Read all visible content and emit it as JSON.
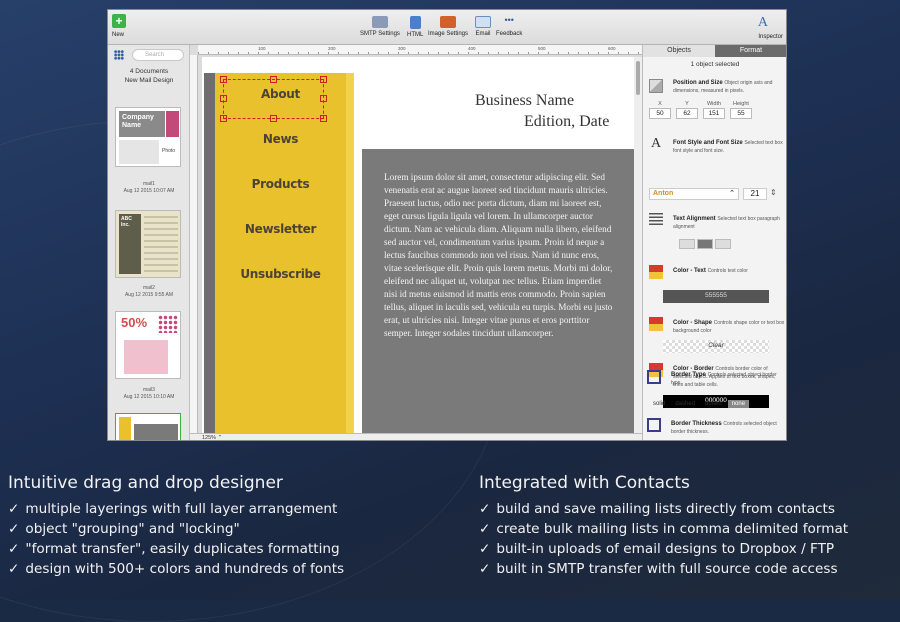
{
  "toolbar": {
    "new_label": "New",
    "buttons": [
      {
        "label": "SMTP Settings",
        "icon": "smtp-icon"
      },
      {
        "label": "HTML",
        "icon": "html-icon"
      },
      {
        "label": "Image Settings",
        "icon": "image-settings-icon"
      },
      {
        "label": "Email",
        "icon": "email-icon"
      },
      {
        "label": "Feedback",
        "icon": "feedback-icon"
      }
    ],
    "inspector_label": "Inspector"
  },
  "sidebar": {
    "search_placeholder": "Search",
    "doc_count": "4 Documents",
    "doc_subtitle": "New Mail Design",
    "thumbs": [
      {
        "name": "mail1",
        "date": "Aug 12 2015 10:07 AM",
        "title": "Company Name",
        "photo": "Photo"
      },
      {
        "name": "mail2",
        "date": "Aug 12 2015 9:55 AM",
        "title": "ABC Inc."
      },
      {
        "name": "mail3",
        "date": "Aug 12 2015 10:10 AM",
        "title": "50%"
      },
      {
        "name": "",
        "date": ""
      }
    ]
  },
  "canvas": {
    "ruler_labels": [
      "100",
      "200",
      "300",
      "400",
      "500",
      "600"
    ],
    "zoom": "125%",
    "nav_items": [
      "About",
      "News",
      "Products",
      "Newsletter",
      "Unsubscribe"
    ],
    "business_name": "Business Name",
    "edition_date": "Edition, Date",
    "body": "Lorem ipsum dolor sit amet, consectetur adipiscing elit. Sed venenatis erat ac augue laoreet sed tincidunt mauris ultricies. Praesent luctus, odio nec porta dictum, diam mi laoreet est, eget cursus ligula ligula vel lorem. In ullamcorper auctor dictum. Nam ac vehicula diam. Aliquam nulla libero, eleifend sed auctor vel, condimentum varius ipsum. Proin id neque a lectus faucibus commodo non vel risus. Nam id nunc eros, vitae scelerisque elit. Proin quis lorem metus. Morbi mi dolor, eleifend nec aliquet ut, volutpat nec tellus. Etiam imperdiet nisi id metus euismod id mattis eros commodo. Proin sapien tellus, aliquet in iaculis sed, vehicula eu turpis. Morbi eu justo erat, ut ultricies nisi. Integer vitae purus et eros porttitor semper. Integer sodales tincidunt ullamcorper."
  },
  "inspector": {
    "tabs": [
      "Objects",
      "Format"
    ],
    "selection": "1 object selected",
    "position_title": "Position and Size",
    "position_desc": "Object origin axis and dimensions, measured in pixels.",
    "fields": [
      {
        "label": "X",
        "value": "50"
      },
      {
        "label": "Y",
        "value": "62"
      },
      {
        "label": "Width",
        "value": "151"
      },
      {
        "label": "Height",
        "value": "55"
      }
    ],
    "font_title": "Font Style and Font Size",
    "font_desc": "Selected text box font style and font size.",
    "font_name": "Anton",
    "font_size": "21",
    "align_title": "Text Alignment",
    "align_desc": "Selected text box paragraph alignment",
    "text_color_title": "Color - Text",
    "text_color_desc": "Controls text color",
    "text_color": "555555",
    "shape_color_title": "Color - Shape",
    "shape_color_desc": "Controls shape color or text box background color",
    "shape_color": "Clear",
    "border_color_title": "Color - Border",
    "border_color_desc": "Controls border color of selected object. Applies to text boxes, shapes, lines and table cells.",
    "border_color": "000000",
    "border_type_title": "Border Type",
    "border_type_desc": "Controls selected object border type.",
    "border_types": [
      "solid",
      "dashed",
      "dotted",
      "none"
    ],
    "border_thick_title": "Border Thickness",
    "border_thick_desc": "Controls selected object border thickness."
  },
  "features": {
    "left_title": "Intuitive drag and drop designer",
    "left_items": [
      "multiple layerings with full layer arrangement",
      "object \"grouping\" and \"locking\"",
      "\"format transfer\", easily duplicates formatting",
      "design with 500+ colors and hundreds of fonts"
    ],
    "right_title": "Integrated with Contacts",
    "right_items": [
      "build and save mailing lists directly from contacts",
      "create bulk mailing lists in comma delimited format",
      "built-in uploads of email designs to Dropbox / FTP",
      "built in SMTP transfer with full source code access"
    ],
    "check": "✓"
  }
}
